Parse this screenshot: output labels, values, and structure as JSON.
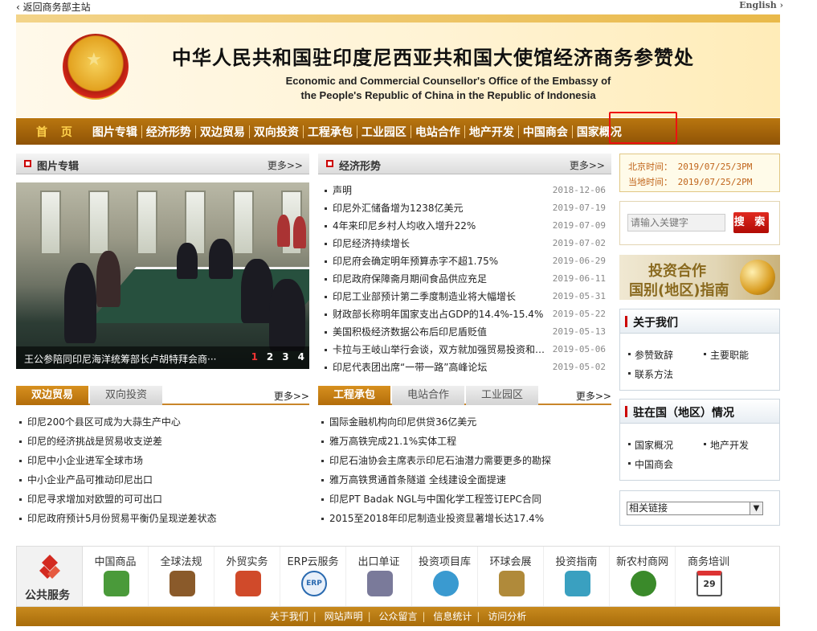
{
  "topbar": {
    "back": "返回商务部主站",
    "english": "English"
  },
  "header": {
    "cn_title": "中华人民共和国驻印度尼西亚共和国大使馆经济商务参赞处",
    "en_title_1": "Economic and Commercial Counsellor's Office of the Embassy of",
    "en_title_2": "the People's Republic of China in the Republic of Indonesia"
  },
  "nav": [
    "首 页",
    "图片专辑",
    "经济形势",
    "双边贸易",
    "双向投资",
    "工程承包",
    "工业园区",
    "电站合作",
    "地产开发",
    "中国商会",
    "国家概况"
  ],
  "photo_section": {
    "title": "图片专辑",
    "more": "更多>>",
    "caption": "王公参陪同印尼海洋统筹部长卢胡特拜会商···",
    "pages": [
      "1",
      "2",
      "3",
      "4"
    ]
  },
  "economy": {
    "title": "经济形势",
    "more": "更多>>",
    "items": [
      {
        "t": "声明",
        "d": "2018-12-06"
      },
      {
        "t": "印尼外汇储备增为1238亿美元",
        "d": "2019-07-19"
      },
      {
        "t": "4年来印尼乡村人均收入增升22%",
        "d": "2019-07-09"
      },
      {
        "t": "印尼经济持续增长",
        "d": "2019-07-02"
      },
      {
        "t": "印尼府会确定明年预算赤字不超1.75%",
        "d": "2019-06-29"
      },
      {
        "t": "印尼政府保障斋月期间食品供应充足",
        "d": "2019-06-11"
      },
      {
        "t": "印尼工业部预计第二季度制造业将大幅增长",
        "d": "2019-05-31"
      },
      {
        "t": "财政部长称明年国家支出占GDP的14.4%-15.4%",
        "d": "2019-05-22"
      },
      {
        "t": "美国积极经济数据公布后印尼盾贬值",
        "d": "2019-05-13"
      },
      {
        "t": "卡拉与王岐山举行会谈，双方就加强贸易投资和…",
        "d": "2019-05-06"
      },
      {
        "t": "印尼代表团出席“一带一路”高峰论坛",
        "d": "2019-05-02"
      }
    ]
  },
  "time": {
    "beijing": "北京时间： 2019/07/25/3PM",
    "local": "当地时间： 2019/07/25/2PM"
  },
  "search": {
    "placeholder": "请输入关键字",
    "button": "搜 索"
  },
  "banner": {
    "line1": "投资合作",
    "line2": "国别(地区)指南"
  },
  "about": {
    "title": "关于我们",
    "links": [
      "参赞致辞",
      "主要职能",
      "联系方法"
    ]
  },
  "country": {
    "title": "驻在国（地区）情况",
    "links": [
      "国家概况",
      "地产开发",
      "中国商会"
    ]
  },
  "related": {
    "label": "相关链接"
  },
  "trade": {
    "tabs": [
      "双边贸易",
      "双向投资"
    ],
    "more": "更多>>",
    "items": [
      "印尼200个县区可成为大蒜生产中心",
      "印尼的经济挑战是贸易收支逆差",
      "印尼中小企业进军全球市场",
      "中小企业产品可推动印尼出口",
      "印尼寻求增加对欧盟的可可出口",
      "印尼政府预计5月份贸易平衡仍呈现逆差状态"
    ]
  },
  "project": {
    "tabs": [
      "工程承包",
      "电站合作",
      "工业园区"
    ],
    "more": "更多>>",
    "items": [
      "国际金融机构向印尼供贷36亿美元",
      "雅万高铁完成21.1%实体工程",
      "印尼石油协会主席表示印尼石油潜力需要更多的勘探",
      "雅万高铁贯通首条隧道 全线建设全面提速",
      "印尼PT Badak NGL与中国化学工程签订EPC合同",
      "2015至2018年印尼制造业投资显著增长达17.4%"
    ]
  },
  "services": {
    "public_label": "公共服务",
    "items": [
      {
        "label": "中国商品",
        "color": "#4a9a3a"
      },
      {
        "label": "全球法规",
        "color": "#8a5a2a"
      },
      {
        "label": "外贸实务",
        "color": "#d04a2a"
      },
      {
        "label": "ERP云服务",
        "color": "#2a6ab0"
      },
      {
        "label": "出口单证",
        "color": "#7a7a9a"
      },
      {
        "label": "投资项目库",
        "color": "#3a9ad0"
      },
      {
        "label": "环球会展",
        "color": "#b08a3a"
      },
      {
        "label": "投资指南",
        "color": "#3aa0c0"
      },
      {
        "label": "新农村商网",
        "color": "#3a8a2a"
      },
      {
        "label": "商务培训",
        "color": "#555555"
      }
    ],
    "calendar_day": "29"
  },
  "footer": [
    "关于我们",
    "网站声明",
    "公众留言",
    "信息统计",
    "访问分析"
  ]
}
